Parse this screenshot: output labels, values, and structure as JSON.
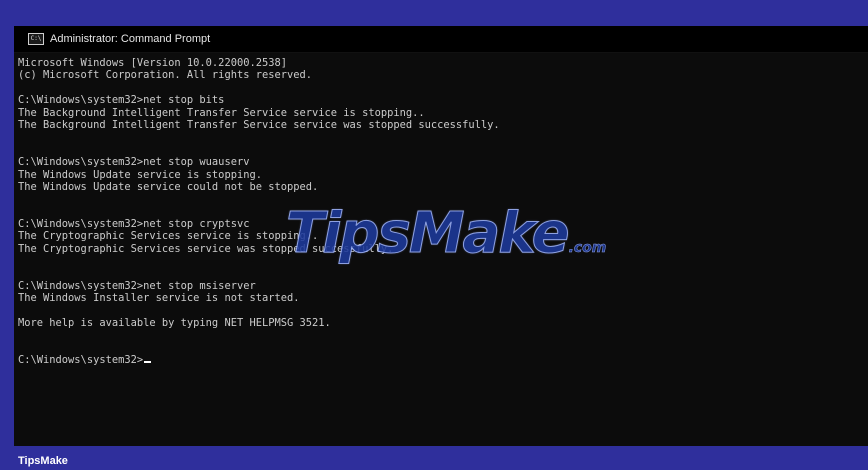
{
  "window": {
    "title": "Administrator: Command Prompt",
    "icon": "cmd-icon",
    "icon_glyph": "C:\\"
  },
  "console": {
    "lines": [
      "Microsoft Windows [Version 10.0.22000.2538]",
      "(c) Microsoft Corporation. All rights reserved.",
      "",
      "C:\\Windows\\system32>net stop bits",
      "The Background Intelligent Transfer Service service is stopping..",
      "The Background Intelligent Transfer Service service was stopped successfully.",
      "",
      "",
      "C:\\Windows\\system32>net stop wuauserv",
      "The Windows Update service is stopping.",
      "The Windows Update service could not be stopped.",
      "",
      "",
      "C:\\Windows\\system32>net stop cryptsvc",
      "The Cryptographic Services service is stopping..",
      "The Cryptographic Services service was stopped successfully.",
      "",
      "",
      "C:\\Windows\\system32>net stop msiserver",
      "The Windows Installer service is not started.",
      "",
      "More help is available by typing NET HELPMSG 3521.",
      "",
      ""
    ],
    "prompt": "C:\\Windows\\system32>"
  },
  "watermark": {
    "text": "TipsMake",
    "suffix": ".com"
  },
  "footer": {
    "brand": "TipsMake"
  },
  "colors": {
    "frame": "#2f2f9c",
    "console_bg": "#0c0c0c",
    "console_text": "#cccccc"
  }
}
